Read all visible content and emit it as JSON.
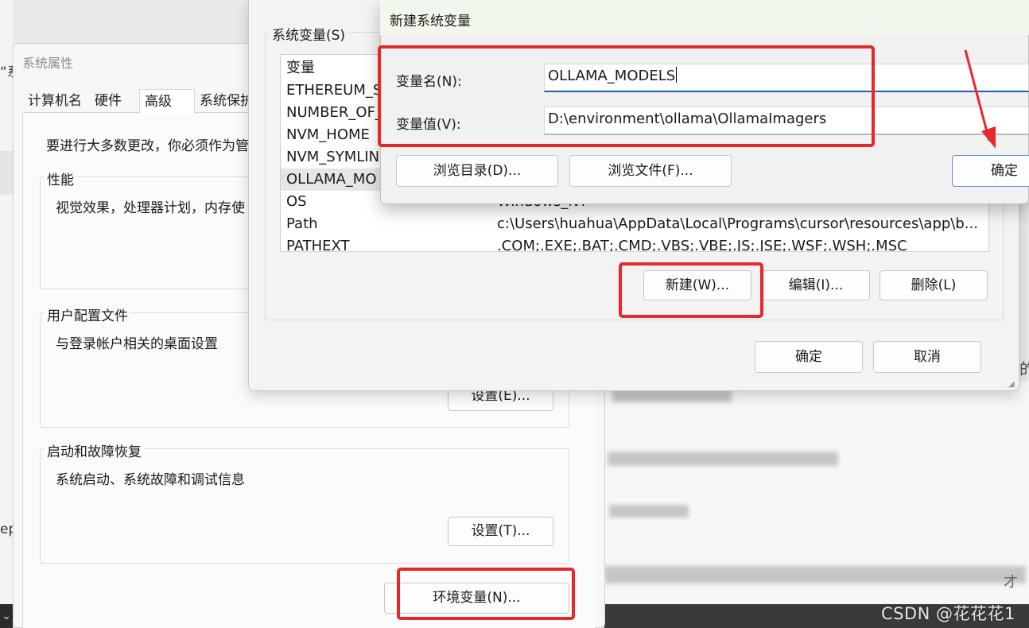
{
  "background": {
    "left_fragment_top": "“系",
    "left_fragment_bottom": "ep",
    "left_taskbar_glyph": "⌄",
    "right_fragment_1": "的",
    "right_fragment_2": "才",
    "watermark": "CSDN @花花花1"
  },
  "system_properties": {
    "title": "系统属性",
    "tabs": [
      {
        "label": "计算机名"
      },
      {
        "label": "硬件"
      },
      {
        "label": "高级"
      },
      {
        "label": "系统保护"
      }
    ],
    "notice": "要进行大多数更改，你必须作为管",
    "performance": {
      "label": "性能",
      "desc": "视觉效果，处理器计划，内存使"
    },
    "user_profiles": {
      "label": "用户配置文件",
      "desc": "与登录帐户相关的桌面设置",
      "button": "设置(E)..."
    },
    "startup_recovery": {
      "label": "启动和故障恢复",
      "desc": "系统启动、系统故障和调试信息",
      "button": "设置(T)..."
    },
    "env_button": "环境变量(N)..."
  },
  "env_vars": {
    "group_label": "系统变量(S)",
    "rows": [
      {
        "name": "变量",
        "value": ""
      },
      {
        "name": "ETHEREUM_S",
        "value": ""
      },
      {
        "name": "NUMBER_OF_",
        "value": ""
      },
      {
        "name": "NVM_HOME",
        "value": ""
      },
      {
        "name": "NVM_SYMLIN",
        "value": ""
      },
      {
        "name": "OLLAMA_MO",
        "value": ""
      },
      {
        "name": "OS",
        "value": "Windows_NT"
      },
      {
        "name": "Path",
        "value": "c:\\Users\\huahua\\AppData\\Local\\Programs\\cursor\\resources\\app\\b..."
      },
      {
        "name": "PATHEXT",
        "value": ".COM;.EXE;.BAT;.CMD;.VBS;.VBE;.JS;.JSE;.WSF;.WSH;.MSC"
      }
    ],
    "buttons": {
      "new": "新建(W)...",
      "edit": "编辑(I)...",
      "delete": "删除(L)"
    },
    "ok": "确定",
    "cancel": "取消"
  },
  "new_var_dialog": {
    "title": "新建系统变量",
    "name_label": "变量名(N):",
    "name_value": "OLLAMA_MODELS",
    "value_label": "变量值(V):",
    "value_value": "D:\\environment\\ollama\\OllamaImagers",
    "browse_dir": "浏览目录(D)...",
    "browse_file": "浏览文件(F)...",
    "ok": "确定"
  },
  "colors": {
    "annotation_red": "#e8272a",
    "focus_blue": "#1f5fa8"
  }
}
